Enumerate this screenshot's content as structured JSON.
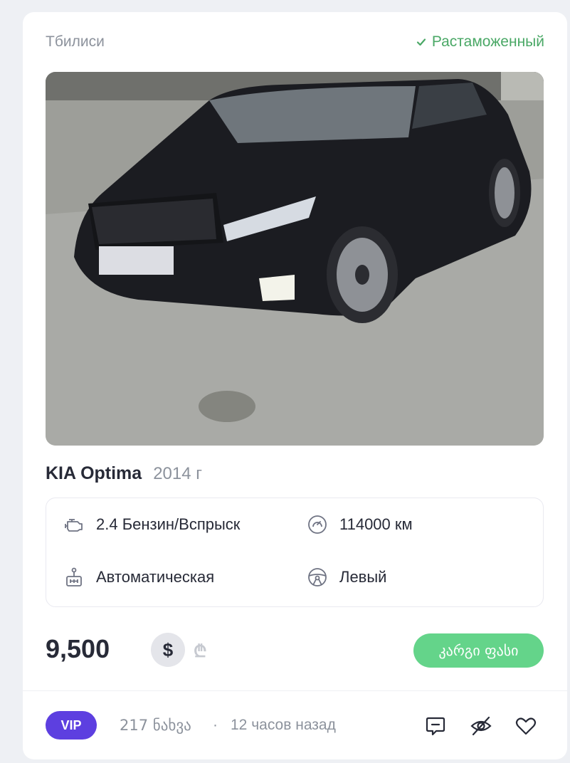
{
  "listing": {
    "location": "Тбилиси",
    "customs_status": "Растаможенный",
    "title": "KIA Optima",
    "year": "2014 г",
    "specs": {
      "engine": "2.4 Бензин/Вспрыск",
      "mileage": "114000 км",
      "transmission": "Автоматическая",
      "steering": "Левый"
    },
    "price": "9,500",
    "currency_usd": "$",
    "currency_gel": "₾",
    "good_price_label": "კარგი ფასი",
    "vip_label": "VIP",
    "views": "217 ნახვა",
    "separator": "·",
    "posted": "12 часов назад"
  },
  "icons": {
    "customs": "check-icon",
    "engine": "engine-icon",
    "mileage": "speedometer-icon",
    "transmission": "gearbox-icon",
    "steering": "steering-wheel-icon",
    "comment": "comment-icon",
    "hide": "eye-slash-icon",
    "favorite": "heart-icon"
  },
  "colors": {
    "customs_green": "#4aa866",
    "good_price_bg": "#64d48a",
    "vip_bg": "#5d3fe0"
  }
}
